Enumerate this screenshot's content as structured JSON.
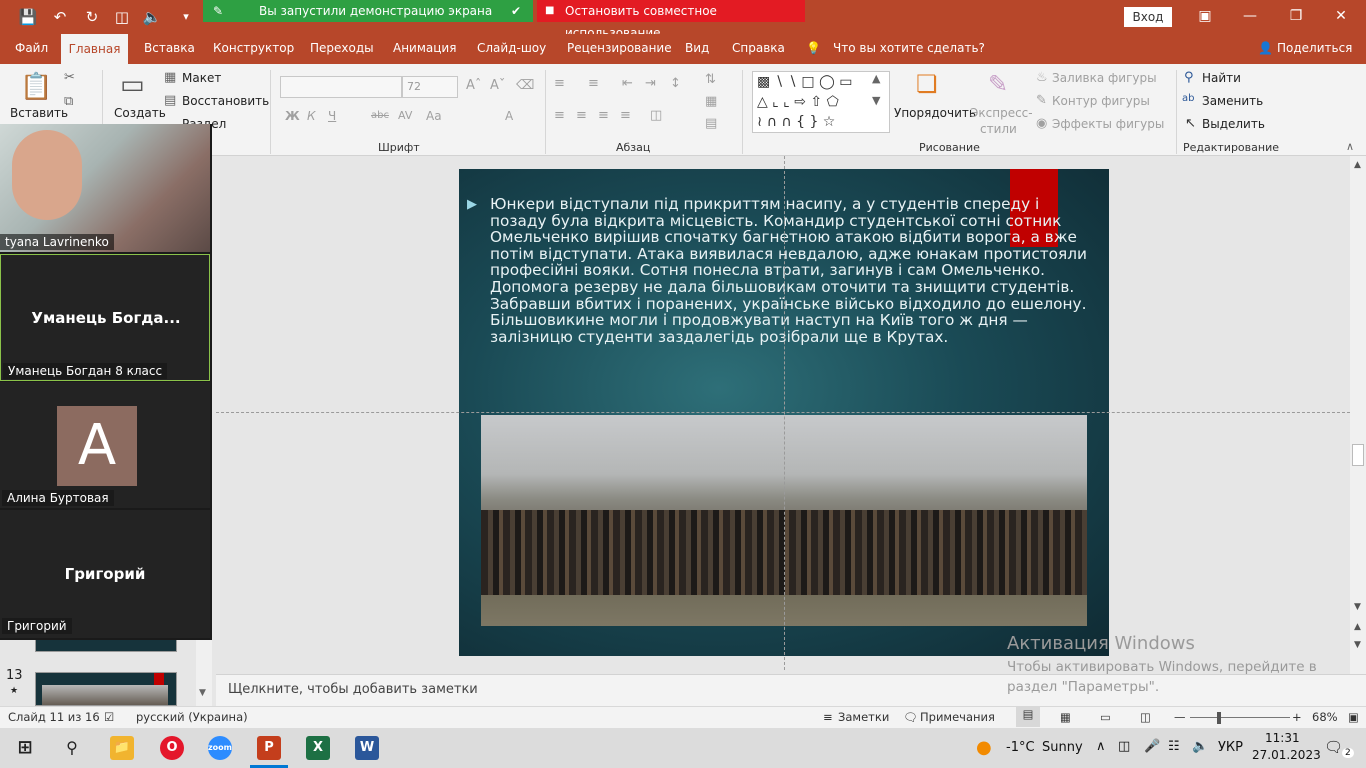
{
  "share": {
    "running_text": "Вы запустили демонстрацию экрана",
    "stop_text": "Остановить совместное использование"
  },
  "titlebar": {
    "signin": "Вход"
  },
  "tabs": [
    "Файл",
    "Главная",
    "Вставка",
    "Конструктор",
    "Переходы",
    "Анимация",
    "Слайд-шоу",
    "Рецензирование",
    "Вид",
    "Справка"
  ],
  "search": {
    "placeholder": "Что вы хотите сделать?"
  },
  "share_button": "Поделиться",
  "ribbon": {
    "paste": "Вставить",
    "create": "Создать",
    "layout": "Макет",
    "reset": "Восстановить",
    "section": "Раздел",
    "font_size": "72",
    "groups": {
      "font": "Шрифт",
      "paragraph": "Абзац",
      "drawing": "Рисование",
      "editing": "Редактирование"
    },
    "arrange": "Упорядочить",
    "quick_styles_1": "Экспресс-",
    "quick_styles_2": "стили",
    "shape_fill": "Заливка фигуры",
    "shape_outline": "Контур фигуры",
    "shape_effects": "Эффекты фигуры",
    "find": "Найти",
    "replace": "Заменить",
    "select": "Выделить",
    "font_buttons": [
      "Ж",
      "К",
      "Ч",
      "abc",
      "AV",
      "Aa",
      "A"
    ]
  },
  "participants": [
    {
      "name": "tyana Lavrinenko",
      "type": "video"
    },
    {
      "name": "Уманець Богдан 8 класс",
      "big": "Уманець  Богда...",
      "type": "text"
    },
    {
      "name": "Алина Буртовая",
      "initial": "A",
      "type": "avatar",
      "avatar_color": "#8c6b60"
    },
    {
      "name": "Григорий",
      "big": "Григорий",
      "type": "text"
    }
  ],
  "thumbs": [
    {
      "number": "13",
      "star": "★"
    }
  ],
  "slide": {
    "bullet": "▶",
    "text": "Юнкери відступали під прикриттям насипу, а у студентів спереду і позаду була відкрита місцевість. Командир студентської сотні сотник Омельченко вирішив спочатку багнетною атакою відбити ворога, а вже потім відступати. Атака виявилася невдалою, адже юнакам протистояли професійні вояки. Сотня понесла втрати, загинув і сам Омельченко. Допомога резерву не дала більшовикам оточити та знищити студентів. Забравши вбитих і поранених, українське військо відходило до ешелону. Більшовикине могли і продовжувати наступ на Київ того ж дня — залізницю студенти  заздалегідь розібрали ще в Крутах."
  },
  "notes_placeholder": "Щелкните, чтобы добавить заметки",
  "activation": {
    "title": "Активация Windows",
    "text": "Чтобы активировать Windows, перейдите в раздел \"Параметры\"."
  },
  "status": {
    "slide": "Слайд 11 из 16",
    "language": "русский (Украина)",
    "notes": "Заметки",
    "comments": "Примечания",
    "zoom": "68%"
  },
  "taskbar": {
    "weather_temp": "-1°C",
    "weather_text": "Sunny",
    "lang": "УКР",
    "time": "11:31",
    "date": "27.01.2023",
    "notif_count": "2"
  }
}
